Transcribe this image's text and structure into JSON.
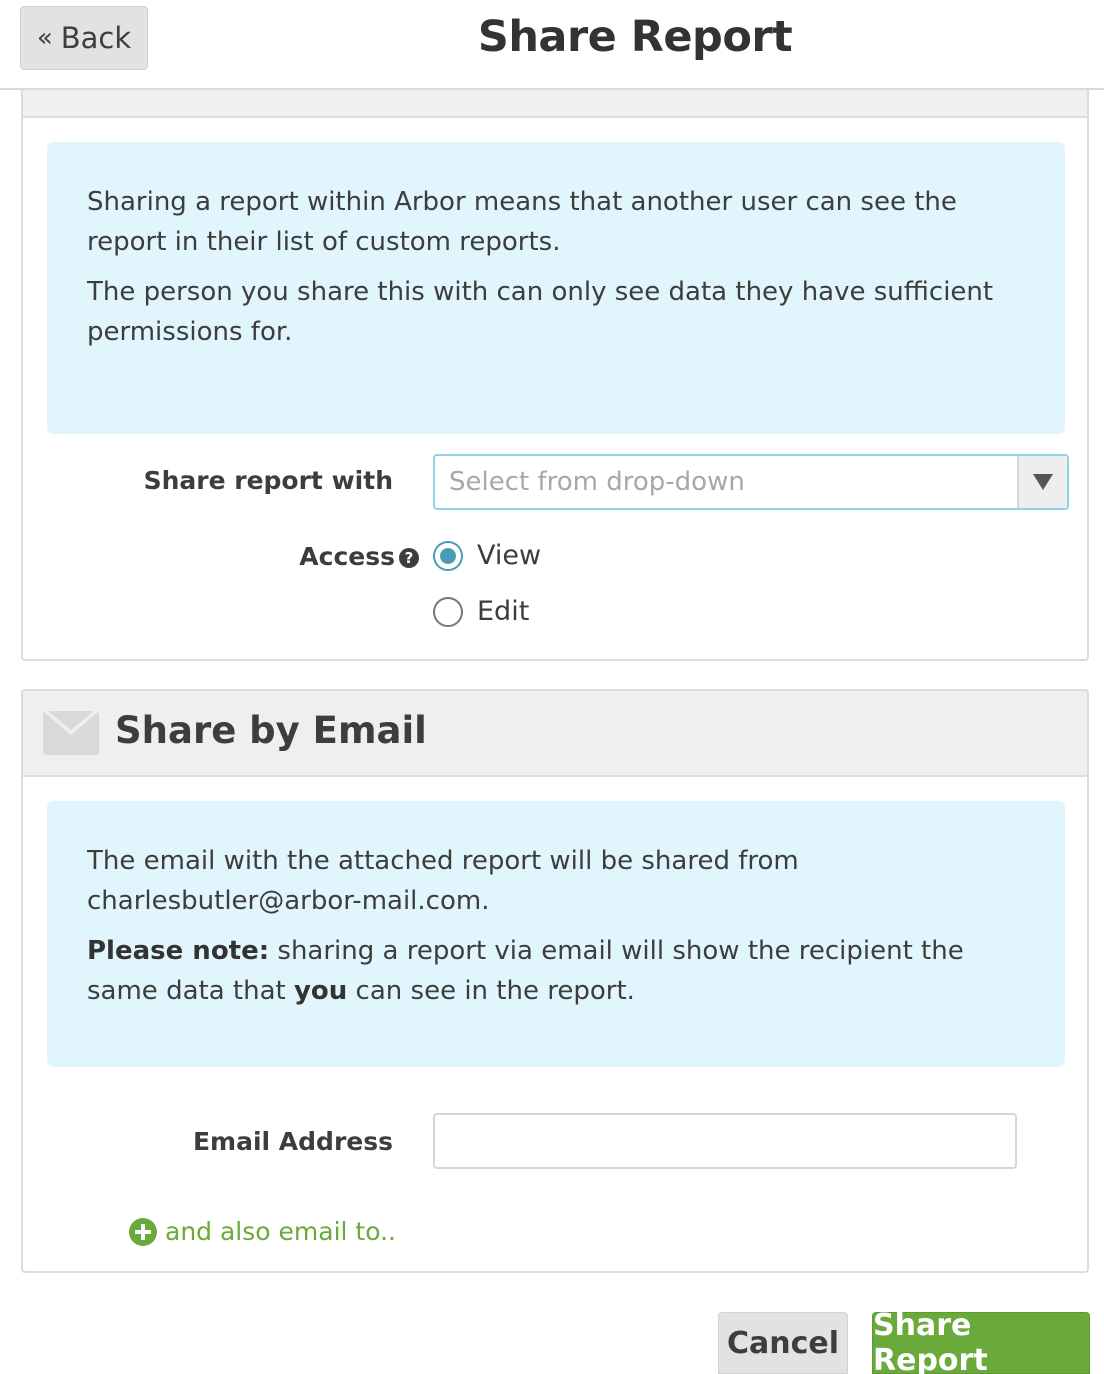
{
  "header": {
    "back_label": "Back",
    "back_glyph": "«",
    "title": "Share Report"
  },
  "share_section": {
    "info_line1": "Sharing a report within Arbor means that another user can see the report in their list of custom reports.",
    "info_line2": "The person you share this with can only see data they have sufficient permissions for.",
    "share_with_label": "Share report with",
    "select_placeholder": "Select from drop-down",
    "access_label": "Access",
    "help_glyph": "?",
    "access_options": [
      {
        "label": "View",
        "selected": true
      },
      {
        "label": "Edit",
        "selected": false
      }
    ]
  },
  "email_section": {
    "title": "Share by Email",
    "info_line1": "The email with the attached report will be shared from charlesbutler@arbor-mail.com.",
    "note_bold": "Please note:",
    "note_text_a": " sharing a report via email will show the recipient the same data that ",
    "note_you": "you",
    "note_text_b": " can see in the report.",
    "email_label": "Email Address",
    "email_value": "",
    "also_email_label": "and also email to.."
  },
  "footer": {
    "cancel_label": "Cancel",
    "share_label": "Share Report"
  },
  "colors": {
    "accent_green": "#6aaa3a",
    "info_bg": "#e0f6fc",
    "radio_blue": "#4a9bb4"
  }
}
